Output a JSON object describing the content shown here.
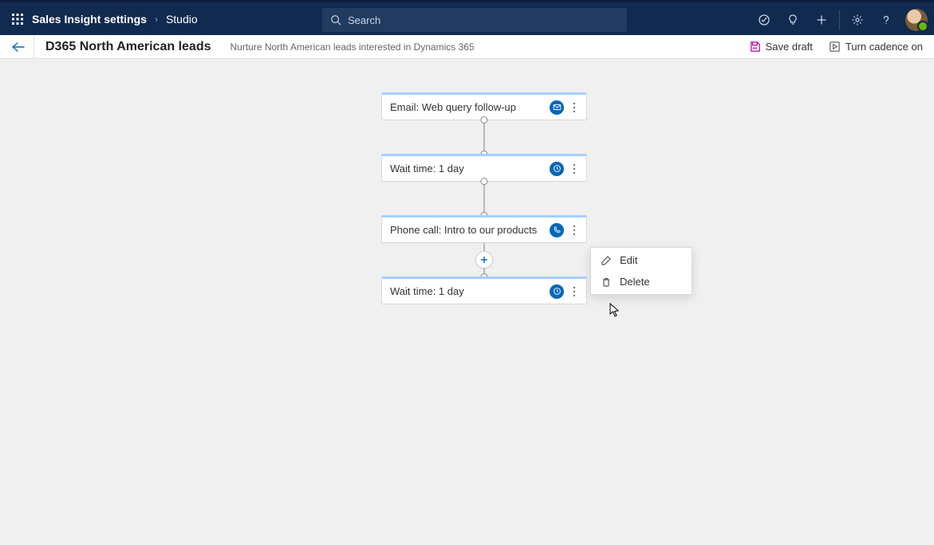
{
  "header": {
    "breadcrumb_root": "Sales Insight settings",
    "breadcrumb_current": "Studio",
    "search_placeholder": "Search"
  },
  "subheader": {
    "title": "D365 North American leads",
    "description": "Nurture North American leads interested in Dynamics 365",
    "save_label": "Save draft",
    "cadence_label": "Turn cadence on"
  },
  "flow": {
    "steps": [
      {
        "label": "Email: Web query follow-up",
        "type": "email"
      },
      {
        "label": "Wait time: 1 day",
        "type": "clock"
      },
      {
        "label": "Phone call: Intro to our products",
        "type": "phone"
      },
      {
        "label": "Wait time: 1 day",
        "type": "clock"
      }
    ]
  },
  "context_menu": {
    "edit": "Edit",
    "delete": "Delete"
  }
}
